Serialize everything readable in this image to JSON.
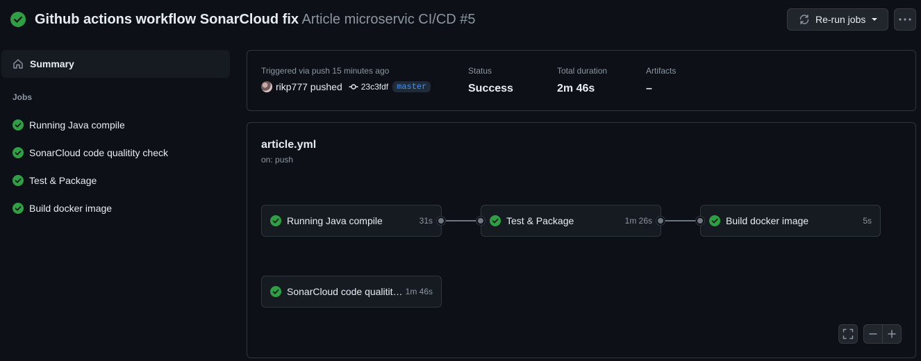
{
  "header": {
    "title_bold": "Github actions workflow SonarCloud fix",
    "title_muted": "Article microservic CI/CD #5",
    "rerun_label": "Re-run jobs"
  },
  "sidebar": {
    "summary_label": "Summary",
    "jobs_heading": "Jobs",
    "jobs": [
      {
        "label": "Running Java compile"
      },
      {
        "label": "SonarCloud code qualitity check"
      },
      {
        "label": "Test & Package"
      },
      {
        "label": "Build docker image"
      }
    ]
  },
  "summary": {
    "triggered_label": "Triggered via push 15 minutes ago",
    "actor": "rikp777 pushed",
    "commit_sha": "23c3fdf",
    "branch": "master",
    "status_label": "Status",
    "status_value": "Success",
    "duration_label": "Total duration",
    "duration_value": "2m 46s",
    "artifacts_label": "Artifacts",
    "artifacts_value": "–"
  },
  "workflow": {
    "file": "article.yml",
    "trigger": "on: push",
    "jobs": [
      {
        "name": "Running Java compile",
        "duration": "31s"
      },
      {
        "name": "Test & Package",
        "duration": "1m 26s"
      },
      {
        "name": "Build docker image",
        "duration": "5s"
      },
      {
        "name": "SonarCloud code qualitity check",
        "duration": "1m 46s"
      }
    ]
  },
  "colors": {
    "success": "#2ea043",
    "background": "#0d1117",
    "border": "#30363d",
    "accent": "#4493f8"
  }
}
